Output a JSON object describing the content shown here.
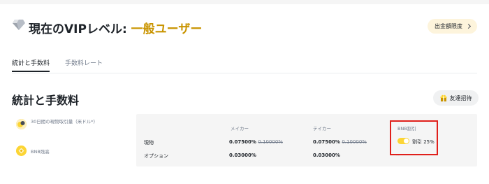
{
  "header": {
    "title_prefix": "現在のVIPレベル: ",
    "vip_level": "一般ユーザー",
    "limit_button": "出金額限度"
  },
  "tabs": [
    {
      "label": "統計と手数料",
      "active": true
    },
    {
      "label": "手数料レート",
      "active": false
    }
  ],
  "section": {
    "title": "統計と手数料",
    "invite_button": "友達招待"
  },
  "stats": [
    {
      "label": "30日間の現物取引量（米ドル*）",
      "icon": "coin-icon"
    },
    {
      "label": "BNB残高",
      "icon": "bnb-icon"
    }
  ],
  "table": {
    "headers": {
      "maker": "メイカー",
      "taker": "テイカー",
      "bnb": "BNB割引"
    },
    "rows": [
      {
        "label": "現物",
        "maker": "0.07500%",
        "maker_old": "0.10000%",
        "taker": "0.07500%",
        "taker_old": "0.10000%",
        "bnb": "割引 25%"
      },
      {
        "label": "オプション",
        "maker": "0.03000%",
        "taker": "0.03000%",
        "bnb": "--"
      }
    ]
  },
  "colors": {
    "accent": "#c99400",
    "toggle": "#fcd535",
    "highlight": "#e0201b"
  }
}
